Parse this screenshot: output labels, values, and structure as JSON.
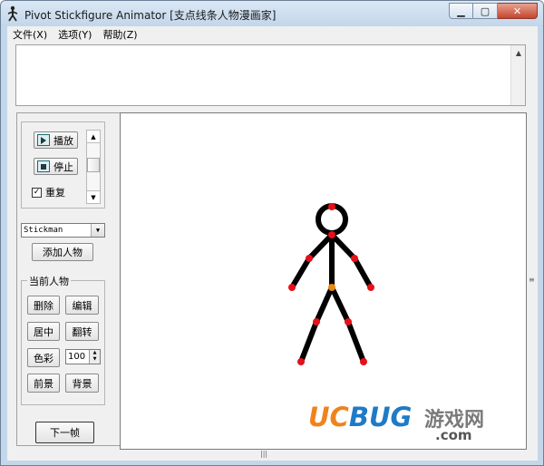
{
  "window": {
    "title": "Pivot Stickfigure Animator [支点线条人物漫画家]",
    "controls": {
      "minimize": "▁",
      "maximize": "▢",
      "close": "✕"
    }
  },
  "menubar": {
    "items": [
      {
        "label": "文件(X)"
      },
      {
        "label": "选项(Y)"
      },
      {
        "label": "帮助(Z)"
      }
    ]
  },
  "playback": {
    "play_label": "播放",
    "stop_label": "停止",
    "repeat_label": "重复",
    "repeat_checked": true
  },
  "figure_type": {
    "selected": "Stickman"
  },
  "add_figure_label": "添加人物",
  "current_figure": {
    "group_label": "当前人物",
    "delete_label": "删除",
    "edit_label": "编辑",
    "center_label": "居中",
    "flip_label": "翻转",
    "color_label": "色彩",
    "size_value": "100",
    "front_label": "前景",
    "back_label": "背景"
  },
  "next_frame_label": "下一帧",
  "icons": {
    "app": "stickman-icon",
    "play": "play-icon",
    "stop": "stop-icon"
  },
  "colors": {
    "joint_red": "#e6101a",
    "joint_orange": "#e88a0d",
    "limb": "#000000",
    "watermark_orange": "#f0831c",
    "watermark_blue": "#1e7bc6"
  },
  "watermark": {
    "brand_uc": "UC",
    "brand_bug": "BUG",
    "brand_cn": "游戏网",
    "domain": ".com"
  }
}
